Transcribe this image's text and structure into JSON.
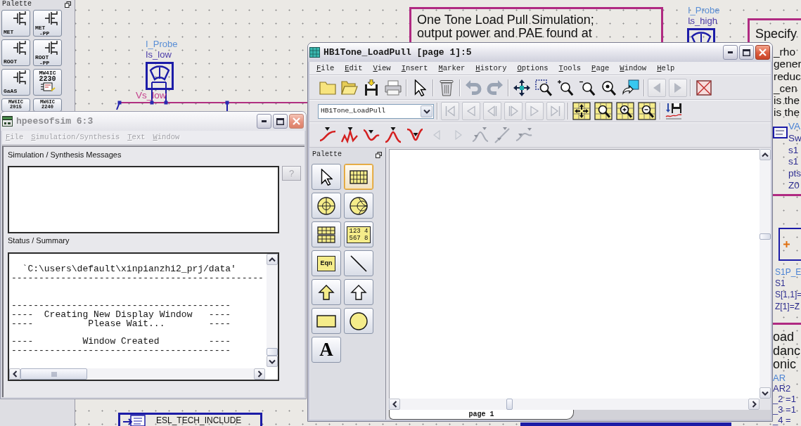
{
  "palette": {
    "title": "Palette",
    "items": [
      {
        "kind": "fet",
        "lines": [
          "MET"
        ]
      },
      {
        "kind": "fet",
        "lines": [
          "MET",
          "-PP"
        ]
      },
      {
        "kind": "fet",
        "lines": [
          "ROOT"
        ]
      },
      {
        "kind": "fet",
        "lines": [
          "ROOT",
          "-PP"
        ]
      },
      {
        "kind": "fet",
        "lines": [
          "GaAS"
        ]
      },
      {
        "kind": "chip",
        "lines": [
          "MW4IC",
          "2230"
        ]
      },
      {
        "kind": "text",
        "lines": [
          "MW6IC",
          "2015"
        ]
      },
      {
        "kind": "text",
        "lines": [
          "MW6IC",
          "2240"
        ]
      }
    ]
  },
  "schematic": {
    "probes": [
      {
        "type": "I_Probe",
        "name": "Is_low"
      },
      {
        "type": "I_Probe",
        "name": "Is_high"
      }
    ],
    "wire_label": "Vs_low",
    "notes": [
      {
        "lines": [
          "One Tone Load Pull Simulation;",
          "output power and PAE found at"
        ]
      },
      {
        "lines": [
          "Specify",
          "_rho",
          "gener",
          "reduc",
          "_cen",
          "is the",
          "is the"
        ]
      },
      {
        "lines": [
          "oad",
          "danc",
          "onic"
        ]
      }
    ],
    "var_block": {
      "title": "VA",
      "lines": [
        "Sw",
        "s1",
        "s1",
        "pts",
        "Z0"
      ]
    },
    "s1p": {
      "title": "S1P_E",
      "lines": [
        "S1",
        "S[1,1]=",
        "Z[1]=Z"
      ]
    },
    "var_block_2": {
      "title": "AR",
      "lines": [
        "AR2",
        "_2 =1",
        "_3 =1",
        "_4 ="
      ]
    },
    "include": {
      "label": "ESL_TECH_INCLUDE"
    }
  },
  "sim_window": {
    "title": "hpeesofsim 6:3",
    "active": false,
    "menu": [
      "File",
      "Simulation/Synthesis",
      "Text",
      "Window"
    ],
    "messages_label": "Simulation / Synthesis Messages",
    "help_button": "?",
    "status_label": "Status / Summary",
    "status_blocks": [
      [
        "  `C:\\users\\default\\xinpianzhi2_prj/data'",
        "----------------------------------------------"
      ],
      [
        "----------------------------------------",
        "----  Creating New Display Window   ----",
        "----          Please Wait...        ----"
      ],
      [
        "----         Window Created         ----",
        "----------------------------------------"
      ]
    ]
  },
  "display_window": {
    "title": "HB1Tone_LoadPull [page 1]:5",
    "active": true,
    "menu": [
      "File",
      "Edit",
      "View",
      "Insert",
      "Marker",
      "History",
      "Options",
      "Tools",
      "Page",
      "Window",
      "Help"
    ],
    "toolbar_1": [
      {
        "items": [
          {
            "kind": "folder",
            "disabled": false
          },
          {
            "kind": "open",
            "disabled": false
          },
          {
            "kind": "save",
            "disabled": false
          },
          {
            "kind": "print",
            "disabled": false
          }
        ]
      },
      {
        "items": [
          {
            "kind": "pointer",
            "disabled": false
          }
        ]
      },
      {
        "items": [
          {
            "kind": "trash",
            "disabled": false
          }
        ]
      },
      {
        "items": [
          {
            "kind": "undo",
            "disabled": true
          },
          {
            "kind": "redo",
            "disabled": true
          }
        ]
      },
      {
        "items": [
          {
            "kind": "move",
            "disabled": false
          },
          {
            "kind": "zoom_box",
            "disabled": false
          },
          {
            "kind": "zoom_in",
            "disabled": false
          },
          {
            "kind": "zoom_out",
            "disabled": false
          },
          {
            "kind": "zoom_one",
            "disabled": false
          },
          {
            "kind": "copy",
            "disabled": false
          }
        ]
      },
      {
        "items": [
          {
            "kind": "prev",
            "disabled": true
          },
          {
            "kind": "next",
            "disabled": true
          }
        ]
      },
      {
        "items": [
          {
            "kind": "clear",
            "disabled": false
          }
        ]
      }
    ],
    "page_select": {
      "value": "HB1Tone_LoadPull"
    },
    "toolbar_2": [
      {
        "items": [
          {
            "kind": "first",
            "disabled": true
          },
          {
            "kind": "back",
            "disabled": true
          },
          {
            "kind": "step_back",
            "disabled": true
          },
          {
            "kind": "step_fwd",
            "disabled": true
          },
          {
            "kind": "fwd",
            "disabled": true
          },
          {
            "kind": "last",
            "disabled": true
          }
        ]
      },
      {
        "items": [
          {
            "kind": "grid_move",
            "disabled": false
          },
          {
            "kind": "grid_zoom",
            "disabled": false
          },
          {
            "kind": "grid_zoom_in",
            "disabled": false
          },
          {
            "kind": "grid_zoom_out",
            "disabled": false
          }
        ]
      },
      {
        "items": [
          {
            "kind": "save_data",
            "disabled": false
          }
        ]
      }
    ],
    "toolbar_3": [
      {
        "items": [
          {
            "kind": "curve_rise",
            "disabled": false
          },
          {
            "kind": "curve_wave",
            "disabled": false
          },
          {
            "kind": "curve_dip",
            "disabled": false
          },
          {
            "kind": "curve_peak",
            "disabled": false
          },
          {
            "kind": "curve_valley",
            "disabled": false
          }
        ]
      },
      {
        "items": [
          {
            "kind": "marker_prev",
            "disabled": true
          },
          {
            "kind": "marker_next",
            "disabled": true
          }
        ]
      },
      {
        "items": [
          {
            "kind": "delta_x",
            "disabled": true
          },
          {
            "kind": "delta_y",
            "disabled": true
          },
          {
            "kind": "delta_xy",
            "disabled": true
          }
        ]
      }
    ],
    "palette": {
      "title": "Palette",
      "items": [
        {
          "kind": "pointer",
          "selected": false
        },
        {
          "kind": "grid",
          "selected": true
        },
        {
          "kind": "polar",
          "selected": false
        },
        {
          "kind": "smith",
          "selected": false
        },
        {
          "kind": "table",
          "selected": false
        },
        {
          "kind": "numbers",
          "lines": [
            "123 4",
            "567 8"
          ],
          "selected": false
        },
        {
          "kind": "equation",
          "label": "Eqn",
          "selected": false
        },
        {
          "kind": "line",
          "selected": false
        },
        {
          "kind": "polyline",
          "selected": false
        },
        {
          "kind": "polygon",
          "selected": false
        },
        {
          "kind": "rectangle",
          "selected": false
        },
        {
          "kind": "ellipse",
          "selected": false
        },
        {
          "kind": "text",
          "label": "A",
          "selected": false
        }
      ]
    },
    "page_tabs": [
      {
        "label": "page 1",
        "selected": true
      }
    ]
  }
}
